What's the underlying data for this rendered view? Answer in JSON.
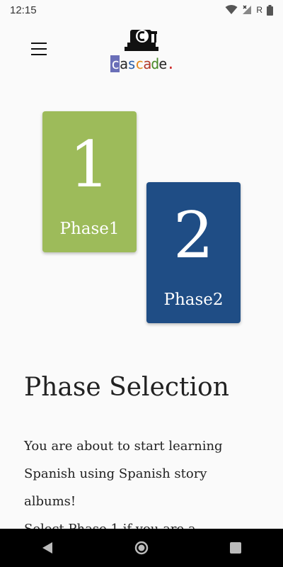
{
  "status_bar": {
    "time": "12:15",
    "signal_label": "R"
  },
  "header": {
    "menu_icon": "hamburger-menu-icon",
    "logo_text": "cascade."
  },
  "phases": [
    {
      "number": "1",
      "label": "Phase1",
      "color": "#9dbb5a"
    },
    {
      "number": "2",
      "label": "Phase2",
      "color": "#1f4d85"
    }
  ],
  "page": {
    "title": "Phase Selection",
    "intro_line1": "You are about to start learning",
    "intro_line2": "Spanish using Spanish story",
    "intro_line3": "albums!",
    "intro_line4": "Select Phase 1 if you are a"
  },
  "nav_bar": {
    "back_icon": "back-triangle-icon",
    "home_icon": "home-circle-icon",
    "recents_icon": "recents-square-icon"
  }
}
